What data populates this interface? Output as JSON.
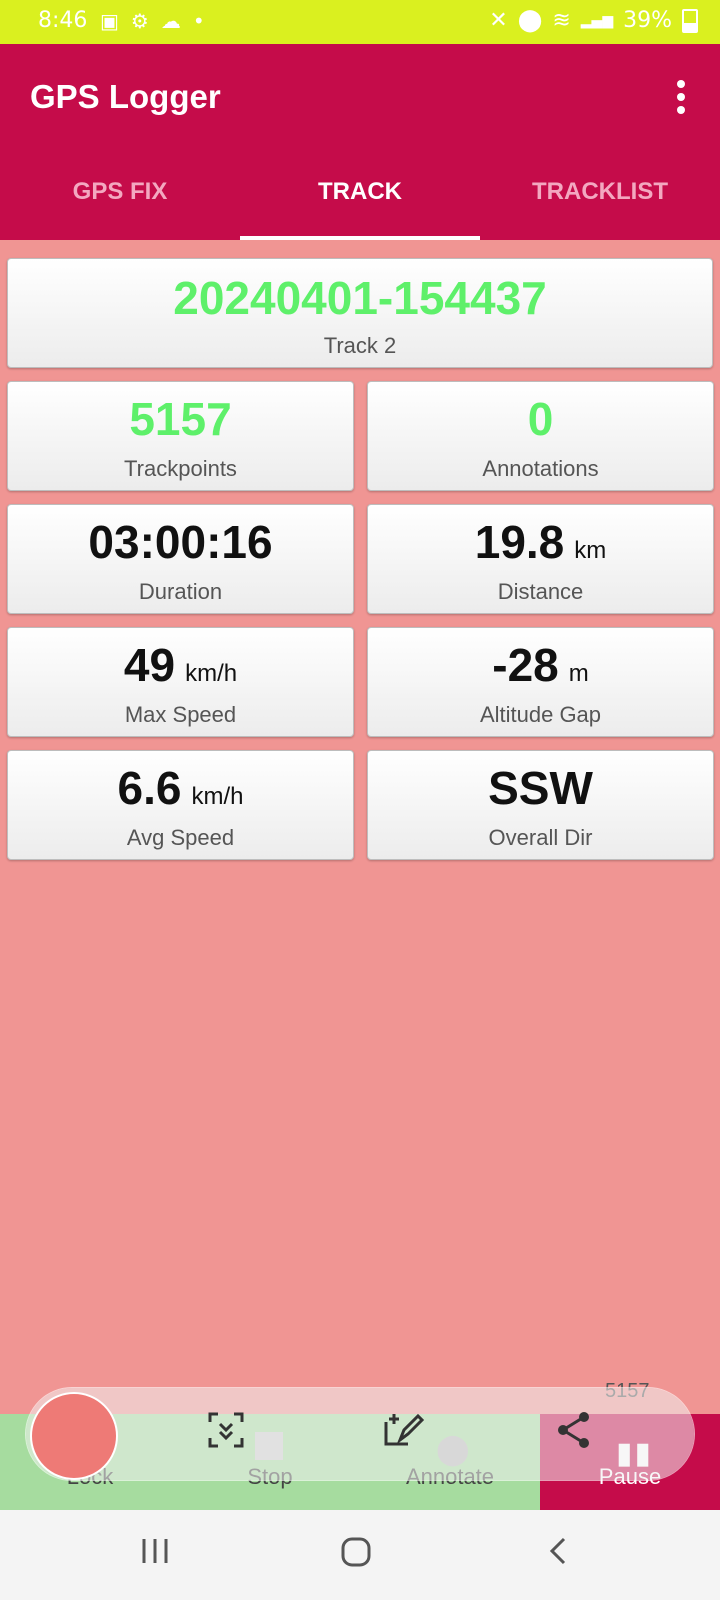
{
  "status_bar": {
    "time": "8:46",
    "battery": "39%"
  },
  "app": {
    "title": "GPS Logger"
  },
  "tabs": [
    {
      "label": "GPS FIX",
      "active": false
    },
    {
      "label": "TRACK",
      "active": true
    },
    {
      "label": "TRACKLIST",
      "active": false
    }
  ],
  "track": {
    "name_card": {
      "value": "20240401-154437",
      "label": "Track 2"
    },
    "trackpoints": {
      "value": "5157",
      "label": "Trackpoints"
    },
    "annotations": {
      "value": "0",
      "label": "Annotations"
    },
    "duration": {
      "value": "03:00:16",
      "label": "Duration"
    },
    "distance": {
      "value": "19.8",
      "unit": "km",
      "label": "Distance"
    },
    "max_speed": {
      "value": "49",
      "unit": "km/h",
      "label": "Max Speed"
    },
    "altitude_gap": {
      "value": "-28",
      "unit": "m",
      "label": "Altitude Gap"
    },
    "avg_speed": {
      "value": "6.6",
      "unit": "km/h",
      "label": "Avg Speed"
    },
    "overall_dir": {
      "value": "SSW",
      "label": "Overall Dir"
    }
  },
  "bottom_bar": {
    "lock": "Lock",
    "stop": "Stop",
    "annotate": "Annotate",
    "pause": "Pause",
    "count": "5157"
  },
  "colors": {
    "primary": "#c50c4a",
    "background": "#f09593",
    "green_value": "#5ef06a",
    "status_bar": "#daf01f"
  }
}
